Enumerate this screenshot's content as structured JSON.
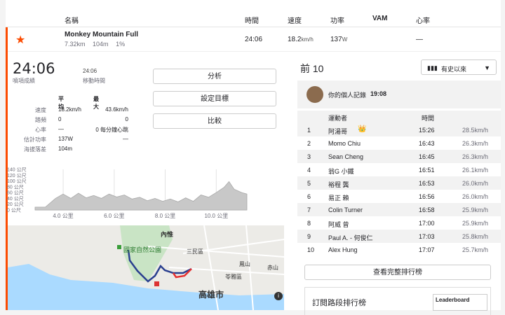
{
  "header": {
    "name": "名稱",
    "time": "時間",
    "speed": "速度",
    "power": "功率",
    "vam": "VAM",
    "heart": "心率"
  },
  "segment": {
    "name": "Monkey Mountain Full",
    "distance": "7.32km",
    "elevation": "104m",
    "grade": "1%",
    "time": "24:06",
    "speed": "18.2km/h",
    "speed_value": "18.2",
    "speed_unit": "km/h",
    "power_value": "137",
    "power_unit": "W",
    "heart": "—",
    "star_icon": "star-icon",
    "accent": "#fc4c02"
  },
  "summary": {
    "best_time": "24:06",
    "best_label": "噴項成績",
    "moving_time": "24:06",
    "moving_label": "移動時間"
  },
  "actions": {
    "analyze": "分析",
    "set_goal": "設定目標",
    "compare": "比較"
  },
  "stats": {
    "avg_header": "平均",
    "max_header": "最大",
    "rows": [
      {
        "label": "速度",
        "avg": "18.2km/h",
        "max": "43.6km/h"
      },
      {
        "label": "踏頻",
        "avg": "0",
        "max": "0"
      },
      {
        "label": "心率",
        "avg": "—",
        "max": "0 每分鐘心跳"
      },
      {
        "label": "估計功率",
        "avg": "137W",
        "max": "—"
      },
      {
        "label": "海拔落差",
        "avg": "104m",
        "max": ""
      }
    ]
  },
  "chart_data": {
    "type": "area",
    "ylabels": [
      "140 公尺",
      "120 公尺",
      "100 公尺",
      "80 公尺",
      "60 公尺",
      "40 公尺",
      "20 公尺",
      "0 公尺"
    ],
    "ylim": [
      0,
      140
    ],
    "xlabels": [
      "4.0 公里",
      "6.0 公里",
      "8.0 公里",
      "10.0 公里"
    ],
    "xticks": [
      4,
      6,
      8,
      10
    ],
    "xlim": [
      2.9,
      11.2
    ],
    "x": [
      2.9,
      3.3,
      3.7,
      4.0,
      4.3,
      4.6,
      4.9,
      5.2,
      5.5,
      5.8,
      6.1,
      6.4,
      6.7,
      7.0,
      7.3,
      7.6,
      7.9,
      8.2,
      8.5,
      8.8,
      9.1,
      9.4,
      9.7,
      10.0,
      10.3,
      10.5,
      10.7,
      11.0,
      11.2
    ],
    "y": [
      10,
      10,
      40,
      55,
      40,
      58,
      42,
      50,
      40,
      55,
      45,
      52,
      38,
      44,
      32,
      40,
      30,
      38,
      28,
      42,
      30,
      52,
      44,
      60,
      78,
      98,
      72,
      60,
      55
    ]
  },
  "map": {
    "labels": {
      "park": "國家自然公園",
      "neihui": "內惟",
      "sanmin": "三民區",
      "lingya": "苓雅區",
      "fengshan": "鳳山",
      "kaohsiung": "高雄市",
      "chishan": "赤山"
    },
    "info_icon": "info-icon"
  },
  "leaderboard": {
    "title": "前 10",
    "filter": "有史以來",
    "pr_text": "你的個人記錄",
    "pr_time": "19:08",
    "col_athlete": "運動者",
    "col_time": "時間",
    "rows": [
      {
        "rank": "1",
        "name": "阿湯哥",
        "time": "15:26",
        "speed": "28.5km/h"
      },
      {
        "rank": "2",
        "name": "Momo Chiu",
        "time": "16:43",
        "speed": "26.3km/h"
      },
      {
        "rank": "3",
        "name": "Sean Cheng",
        "time": "16:45",
        "speed": "26.3km/h"
      },
      {
        "rank": "4",
        "name": "翁G 小鐵",
        "time": "16:51",
        "speed": "26.1km/h"
      },
      {
        "rank": "5",
        "name": "裕程 龔",
        "time": "16:53",
        "speed": "26.0km/h"
      },
      {
        "rank": "6",
        "name": "易正 賴",
        "time": "16:56",
        "speed": "26.0km/h"
      },
      {
        "rank": "7",
        "name": "Colin Turner",
        "time": "16:58",
        "speed": "25.9km/h"
      },
      {
        "rank": "8",
        "name": "阿威 曾",
        "time": "17:00",
        "speed": "25.9km/h"
      },
      {
        "rank": "9",
        "name": "Paul A. - 何俊仁",
        "time": "17:03",
        "speed": "25.8km/h"
      },
      {
        "rank": "10",
        "name": "Alex Hung",
        "time": "17:07",
        "speed": "25.7km/h"
      }
    ],
    "full_button": "查看完整排行榜",
    "subscribe": "訂閱路段排行榜",
    "badge": "Leaderboard"
  }
}
